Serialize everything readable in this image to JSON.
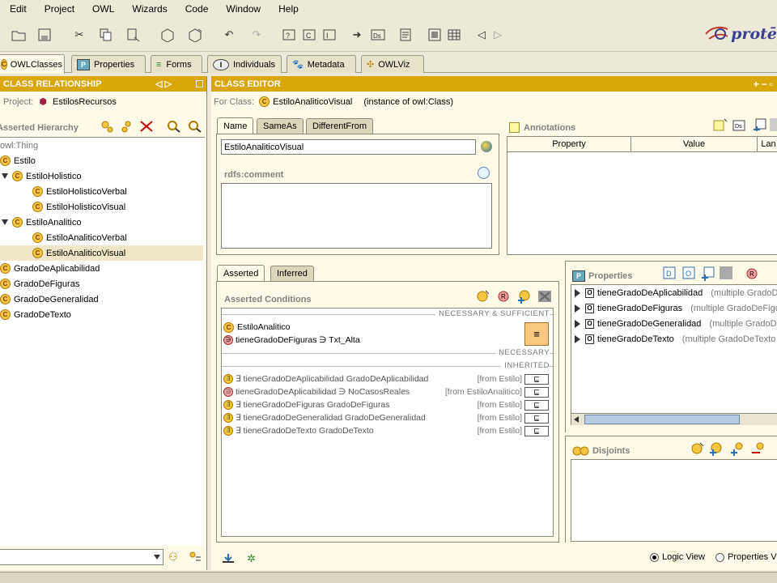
{
  "menu": [
    "Edit",
    "Project",
    "OWL",
    "Wizards",
    "Code",
    "Window",
    "Help"
  ],
  "logo_text": "protē",
  "main_tabs": [
    "OWLClasses",
    "Properties",
    "Forms",
    "Individuals",
    "Metadata",
    "OWLViz"
  ],
  "left": {
    "header": "CLASS RELATIONSHIP",
    "project_label": "Project:",
    "project_name": "EstilosRecursos",
    "hierarchy_label": "Asserted Hierarchy",
    "tree": [
      "owl:Thing",
      "Estilo",
      "EstiloHolistico",
      "EstiloHolisticoVerbal",
      "EstiloHolisticoVisual",
      "EstiloAnalitico",
      "EstiloAnaliticoVerbal",
      "EstiloAnaliticoVisual",
      "GradoDeAplicabilidad",
      "GradoDeFiguras",
      "GradoDeGeneralidad",
      "GradoDeTexto"
    ]
  },
  "editor": {
    "header": "CLASS EDITOR",
    "for_class_label": "For Class:",
    "class_name": "EstiloAnaliticoVisual",
    "instance_of": "(instance of owl:Class)",
    "tabs": [
      "Name",
      "SameAs",
      "DifferentFrom"
    ],
    "name_value": "EstiloAnaliticoVisual",
    "comment_label": "rdfs:comment",
    "annotations_label": "Annotations",
    "annotation_cols": [
      "Property",
      "Value",
      "Lan"
    ],
    "cond_tabs": [
      "Asserted",
      "Inferred"
    ],
    "conditions_label": "Asserted Conditions",
    "nec_suff": "NECESSARY & SUFFICIENT",
    "necessary": "NECESSARY",
    "inherited": "INHERITED",
    "ns_rows": [
      "EstiloAnalitico",
      "tieneGradoDeFiguras ∋ Txt_Alta"
    ],
    "equiv_symbol": "≡",
    "inherited_rows": [
      {
        "text": "∃ tieneGradoDeAplicabilidad GradoDeAplicabilidad",
        "from": "[from Estilo]"
      },
      {
        "text": "tieneGradoDeAplicabilidad ∋ NoCasosReales",
        "from": "[from EstiloAnalitico]"
      },
      {
        "text": "∃ tieneGradoDeFiguras GradoDeFiguras",
        "from": "[from Estilo]"
      },
      {
        "text": "∃ tieneGradoDeGeneralidad GradoDeGeneralidad",
        "from": "[from Estilo]"
      },
      {
        "text": "∃ tieneGradoDeTexto GradoDeTexto",
        "from": "[from Estilo]"
      }
    ],
    "subset_symbol": "⊑",
    "properties_label": "Properties",
    "properties": [
      {
        "name": "tieneGradoDeAplicabilidad",
        "range": "(multiple GradoD"
      },
      {
        "name": "tieneGradoDeFiguras",
        "range": "(multiple GradoDeFigu"
      },
      {
        "name": "tieneGradoDeGeneralidad",
        "range": "(multiple GradoDe"
      },
      {
        "name": "tieneGradoDeTexto",
        "range": "(multiple GradoDeTexto"
      }
    ],
    "disjoints_label": "Disjoints",
    "views": [
      "Logic View",
      "Properties V"
    ]
  }
}
